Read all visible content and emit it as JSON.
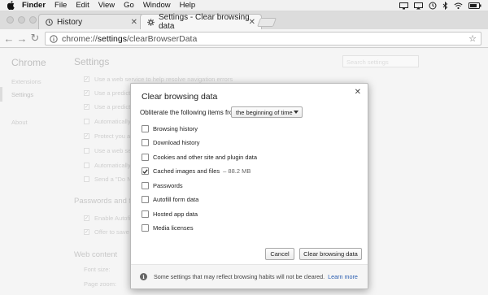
{
  "menubar": {
    "app": "Finder",
    "items": [
      "File",
      "Edit",
      "View",
      "Go",
      "Window",
      "Help"
    ]
  },
  "tabs": [
    {
      "title": "History",
      "icon": "clock-icon"
    },
    {
      "title": "Settings - Clear browsing data",
      "icon": "gear-icon"
    }
  ],
  "omnibox": {
    "scheme": "chrome://",
    "host": "settings",
    "path": "/clearBrowserData"
  },
  "background": {
    "nav_title": "Chrome",
    "nav_items": [
      "Extensions",
      "Settings",
      "About"
    ],
    "main_title": "Settings",
    "search_placeholder": "Search settings",
    "rows": [
      "Use a web service to help resolve navigation errors",
      "Use a predicti",
      "Use a predicti",
      "Automatically",
      "Protect you a",
      "Use a web se",
      "Automatically",
      "Send a \"Do N"
    ],
    "section_passwords": "Passwords and fo",
    "password_rows": [
      "Enable Autofil",
      "Offer to save y"
    ],
    "section_web": "Web content",
    "web_rows": [
      "Font size:",
      "Page zoom:"
    ]
  },
  "dialog": {
    "title": "Clear browsing data",
    "obliterate_label": "Obliterate the following items from:",
    "period": "the beginning of time",
    "options": [
      {
        "label": "Browsing history",
        "checked": false,
        "extra": ""
      },
      {
        "label": "Download history",
        "checked": false,
        "extra": ""
      },
      {
        "label": "Cookies and other site and plugin data",
        "checked": false,
        "extra": ""
      },
      {
        "label": "Cached images and files",
        "checked": true,
        "extra": "– 88.2 MB"
      },
      {
        "label": "Passwords",
        "checked": false,
        "extra": ""
      },
      {
        "label": "Autofill form data",
        "checked": false,
        "extra": ""
      },
      {
        "label": "Hosted app data",
        "checked": false,
        "extra": ""
      },
      {
        "label": "Media licenses",
        "checked": false,
        "extra": ""
      }
    ],
    "cancel_label": "Cancel",
    "clear_label": "Clear browsing data",
    "footer_text": "Some settings that may reflect browsing habits will not be cleared.",
    "learn_more": "Learn more"
  }
}
